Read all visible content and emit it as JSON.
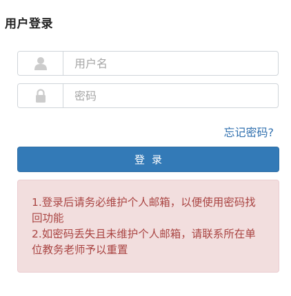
{
  "header": {
    "title": "用户登录"
  },
  "form": {
    "username": {
      "placeholder": "用户名",
      "value": "",
      "icon": "user-icon"
    },
    "password": {
      "placeholder": "密码",
      "value": "",
      "icon": "lock-icon"
    },
    "forgot_label": "忘记密码?",
    "submit_label": "登录"
  },
  "notice": {
    "line1": "1.登录后请务必维护个人邮箱，以便使用密码找回功能",
    "line2": "2.如密码丢失且未维护个人邮箱，请联系所在单位教务老师予以重置"
  },
  "colors": {
    "primary": "#337ab7",
    "link": "#2f6fae",
    "notice_bg": "#f2dede",
    "notice_text": "#a94442"
  }
}
